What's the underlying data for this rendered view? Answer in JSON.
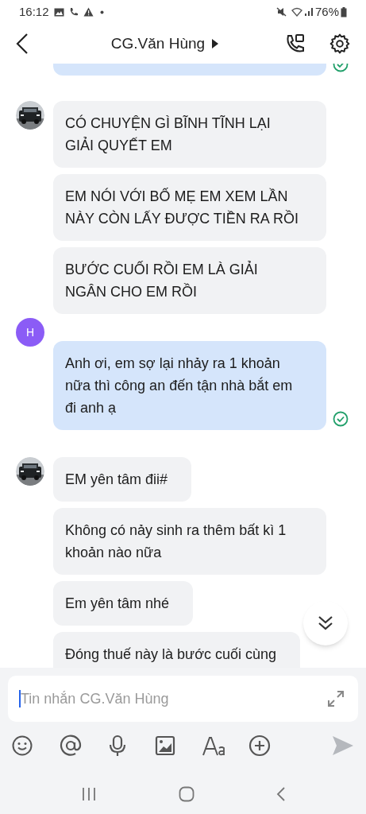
{
  "status_bar": {
    "time": "16:12",
    "battery": "76%"
  },
  "header": {
    "title": "CG.Văn Hùng"
  },
  "groups": [
    {
      "kind": "outgoing",
      "messages": [
        {
          "kind": "cut",
          "seen": true
        }
      ]
    },
    {
      "kind": "incoming",
      "avatar": {
        "kind": "picture"
      },
      "messages": [
        {
          "kind": "text",
          "text": "CÓ CHUYỆN GÌ BĨNH TĨNH LẠI GIẢI QUYẾT EM",
          "seen": false
        },
        {
          "kind": "text",
          "text": "EM NÓI VỚI BỐ MẸ EM XEM LẦN NÀY CÒN LẤY ĐƯỢC TIỀN RA RỒI",
          "seen": false
        },
        {
          "kind": "text",
          "text": "BƯỚC CUỐI RỒI EM LÀ GIẢI NGÂN CHO EM RỒI",
          "seen": false
        }
      ]
    },
    {
      "kind": "outgoing",
      "avatar": {
        "kind": "letter",
        "letter": "H"
      },
      "messages": [
        {
          "kind": "text",
          "text": "Anh ơi, em sợ lại nhảy ra 1 khoản nữa thì công an đến tận nhà bắt em đi anh ạ",
          "seen": true
        }
      ]
    },
    {
      "kind": "incoming",
      "avatar": {
        "kind": "picture"
      },
      "messages": [
        {
          "kind": "text",
          "text": "EM yên tâm đii#",
          "seen": false
        },
        {
          "kind": "text",
          "text": "Không có nảy sinh ra thêm bất kì 1 khoản nào nữa",
          "seen": false
        },
        {
          "kind": "text",
          "text": "Em yên tâm nhé",
          "seen": false
        },
        {
          "kind": "text",
          "text": "Đóng thuế này là bước cuối cùng",
          "seen": false
        }
      ]
    }
  ],
  "composer": {
    "placeholder": "Tin nhắn CG.Văn Hùng"
  }
}
